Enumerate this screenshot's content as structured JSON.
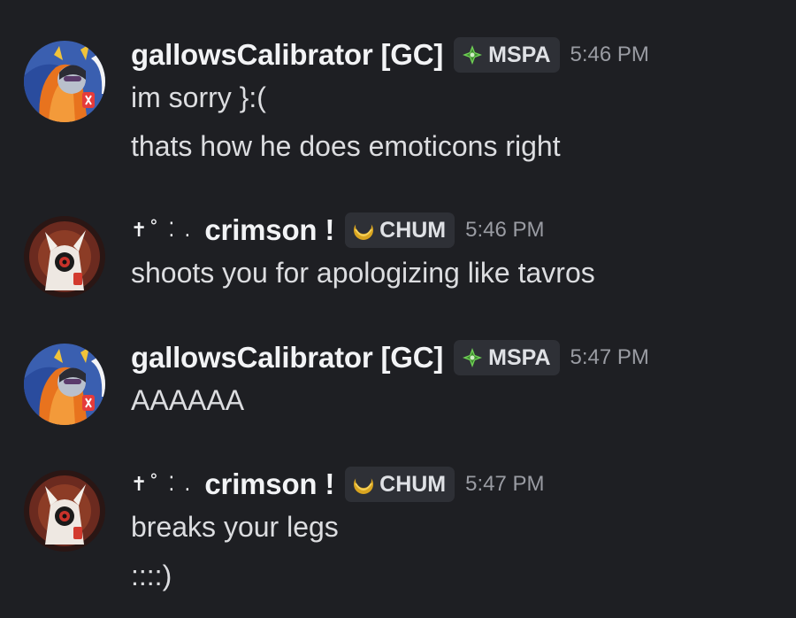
{
  "messages": [
    {
      "username": "gallowsCalibrator [GC]",
      "decoration": "",
      "tag": {
        "label": "MSPA",
        "icon": "green-diamond-icon",
        "color": "#5fbf4a"
      },
      "time": "5:46 PM",
      "lines": [
        "im sorry }:(",
        "thats how he does emoticons right"
      ]
    },
    {
      "username": "crimson !",
      "decoration": "✝˚ ⁚ .",
      "tag": {
        "label": "CHUM",
        "icon": "gold-crescent-icon",
        "color": "#d4a51d"
      },
      "time": "5:46 PM",
      "lines": [
        "shoots you for apologizing like tavros"
      ]
    },
    {
      "username": "gallowsCalibrator [GC]",
      "decoration": "",
      "tag": {
        "label": "MSPA",
        "icon": "green-diamond-icon",
        "color": "#5fbf4a"
      },
      "time": "5:47 PM",
      "lines": [
        "AAAAAA"
      ]
    },
    {
      "username": "crimson !",
      "decoration": "✝˚ ⁚ .",
      "tag": {
        "label": "CHUM",
        "icon": "gold-crescent-icon",
        "color": "#d4a51d"
      },
      "time": "5:47 PM",
      "lines": [
        "breaks your legs",
        "::::)"
      ]
    }
  ]
}
